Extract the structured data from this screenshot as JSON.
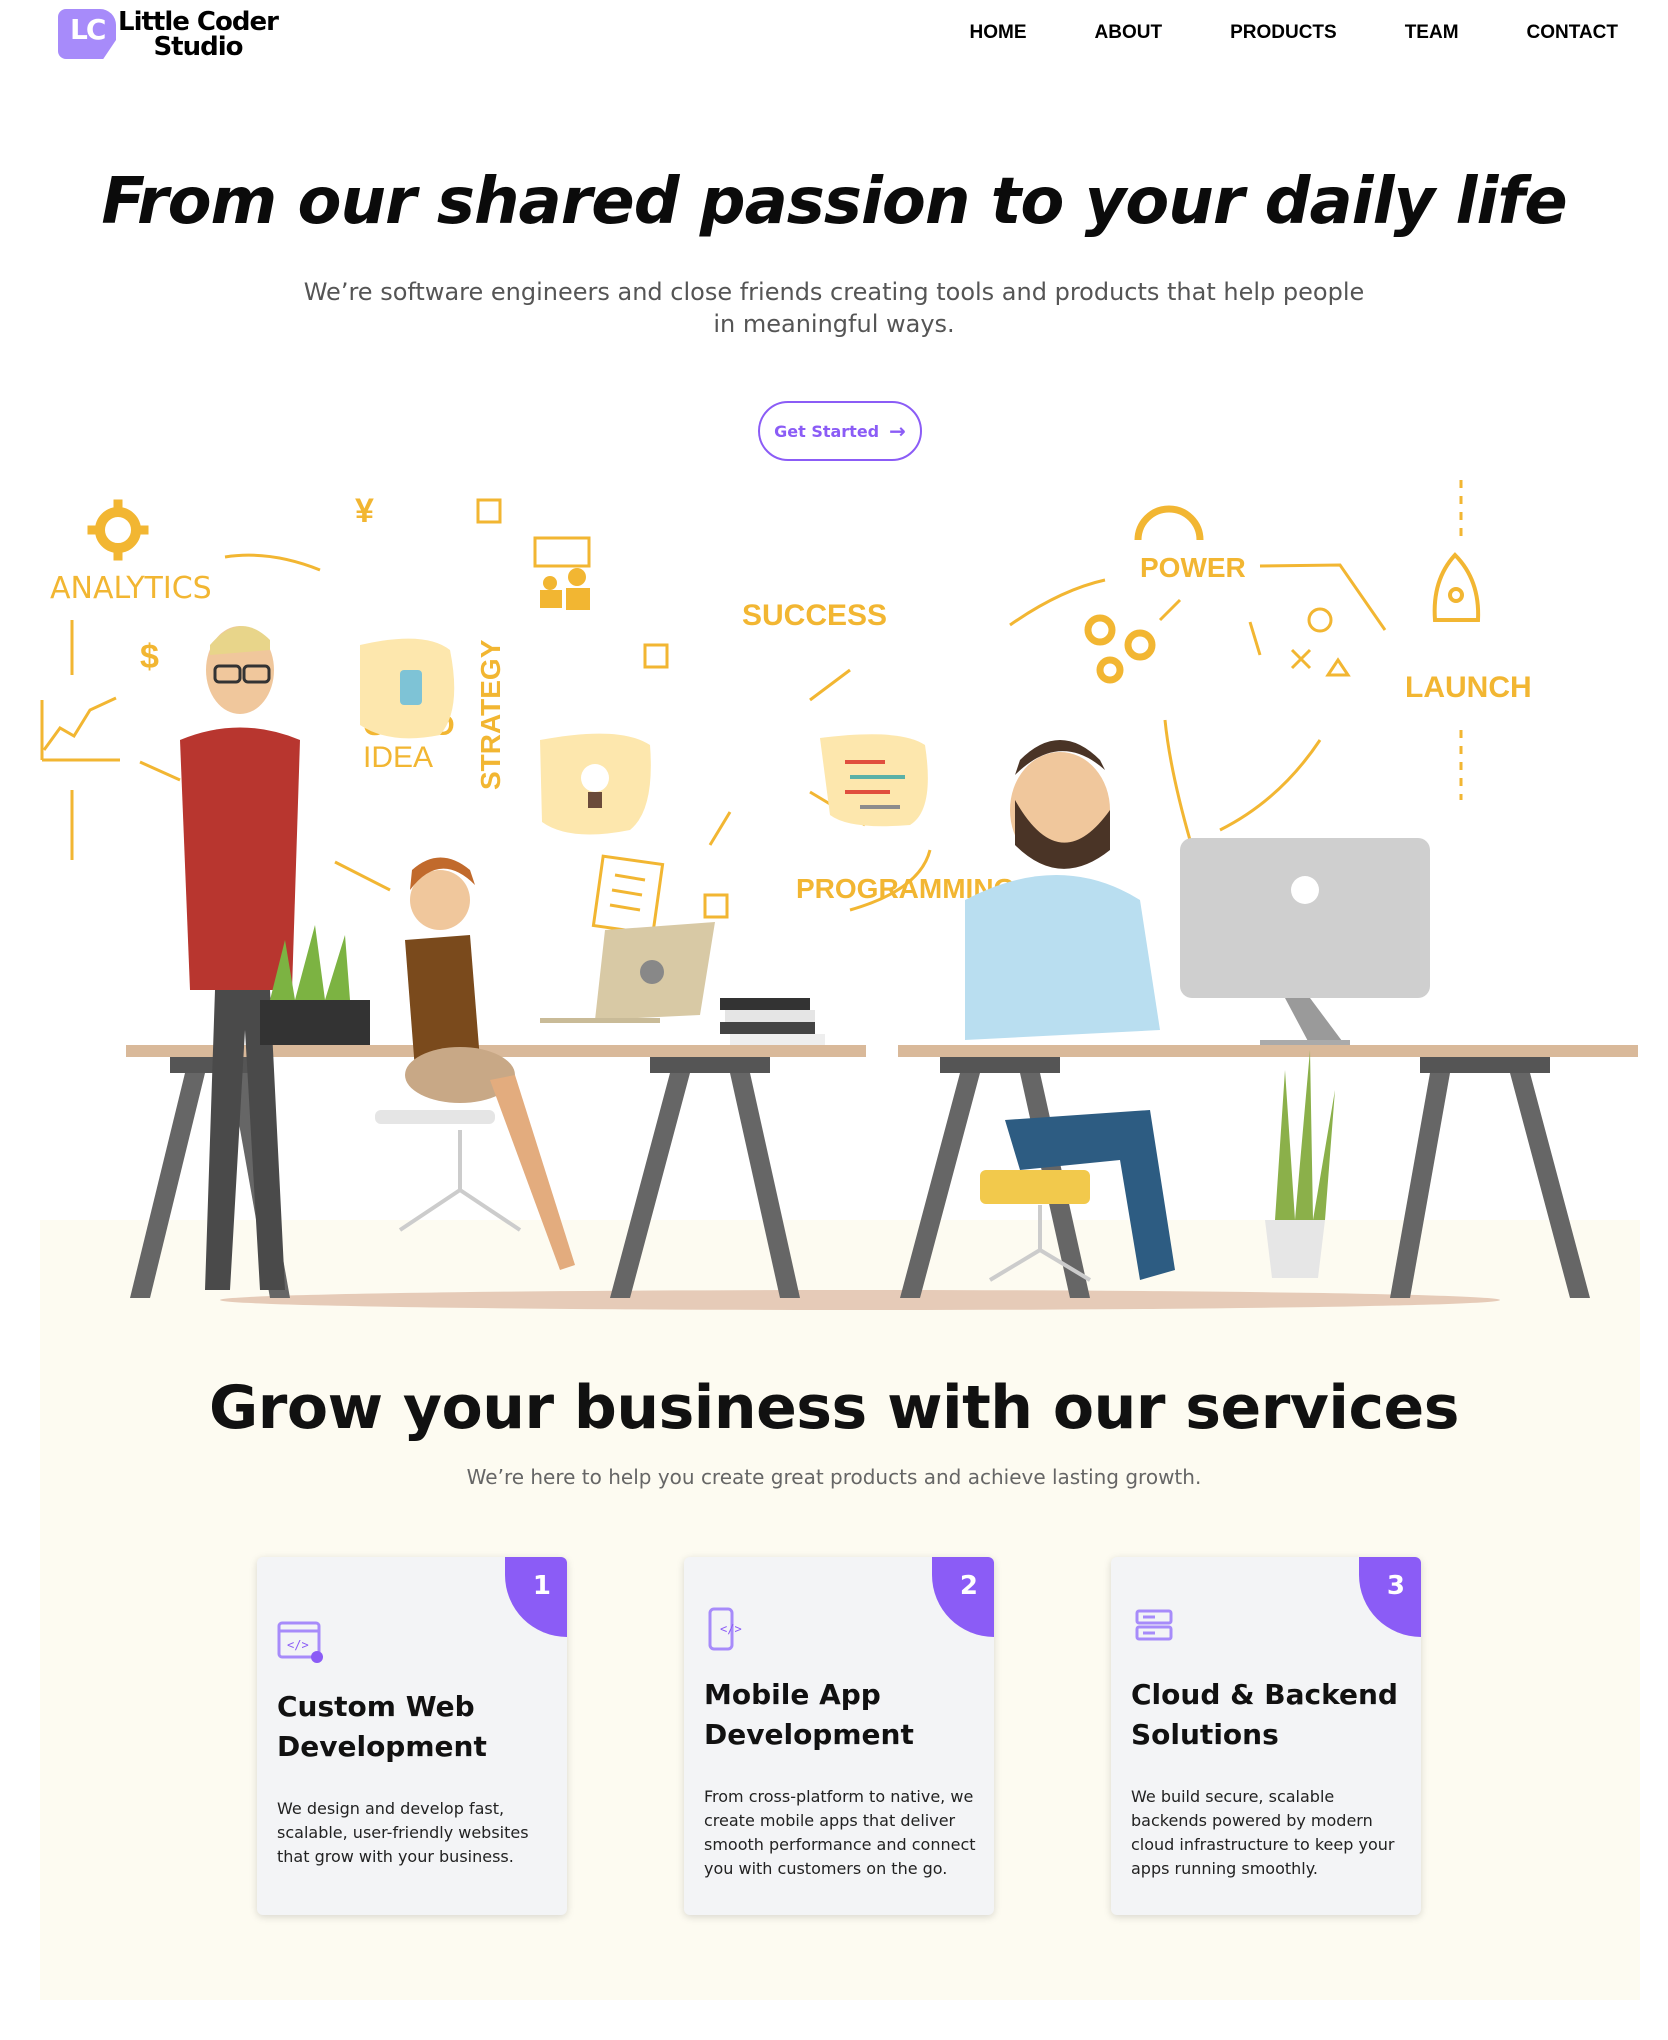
{
  "brand": {
    "logo_mark": "LC",
    "name_line1": "Little Coder",
    "name_line2": "Studio"
  },
  "nav": {
    "items": [
      "HOME",
      "ABOUT",
      "PRODUCTS",
      "TEAM",
      "CONTACT"
    ]
  },
  "hero": {
    "title": "From our shared passion to your daily life",
    "subtitle": "We’re software engineers and close friends creating tools and products that help people in meaningful ways.",
    "cta_label": "Get Started",
    "cta_icon": "arrow-right-icon"
  },
  "illustration": {
    "words": [
      "ANALYTICS",
      "SUCCESS",
      "POWER",
      "LAUNCH",
      "GOOD",
      "IDEA",
      "STRATEGY",
      "PROGRAMMING"
    ],
    "currency": [
      "¥",
      "$"
    ]
  },
  "services": {
    "title": "Grow your business with our services",
    "subtitle": "We’re here to help you create great products and achieve lasting growth.",
    "cards": [
      {
        "number": "1",
        "title": "Custom Web Development",
        "description": "We design and develop fast, scalable, user-friendly websites that grow with your business.",
        "icon": "web-code-icon"
      },
      {
        "number": "2",
        "title": "Mobile App Development",
        "description": "From cross-platform to native, we create mobile apps that deliver smooth performance and connect you with customers on the go.",
        "icon": "mobile-code-icon"
      },
      {
        "number": "3",
        "title": "Cloud & Backend Solutions",
        "description": "We build secure, scalable backends powered by modern cloud infrastructure to keep your apps running smoothly.",
        "icon": "server-icon"
      }
    ]
  },
  "colors": {
    "accent": "#8b5cf6",
    "logo_purple": "#a78bfa",
    "doodle_yellow": "#f2b632",
    "cream_bg": "#fdfbf1",
    "card_bg": "#f3f4f6"
  }
}
